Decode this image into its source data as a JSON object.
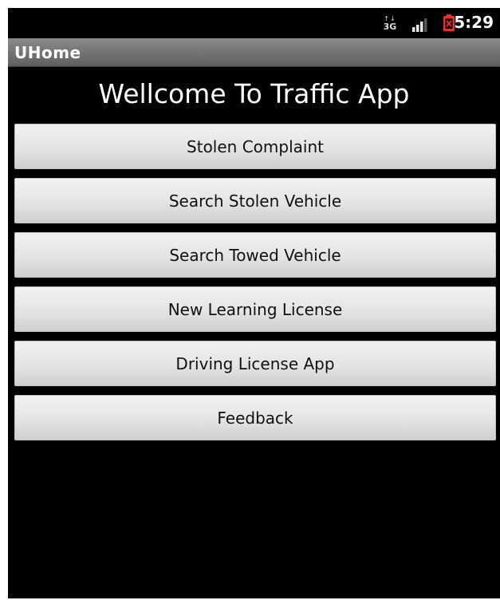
{
  "status_bar": {
    "network_type": "3G",
    "time": "5:29",
    "icons": [
      "network-3g-icon",
      "signal-strength-icon",
      "battery-low-icon"
    ],
    "battery_color": "#e53030"
  },
  "app": {
    "title": "UHome",
    "welcome": "Wellcome To Traffic App"
  },
  "menu": {
    "items": [
      {
        "label": "Stolen Complaint"
      },
      {
        "label": "Search Stolen Vehicle"
      },
      {
        "label": "Search Towed Vehicle"
      },
      {
        "label": "New Learning License"
      },
      {
        "label": "Driving License App"
      },
      {
        "label": "Feedback"
      }
    ]
  }
}
